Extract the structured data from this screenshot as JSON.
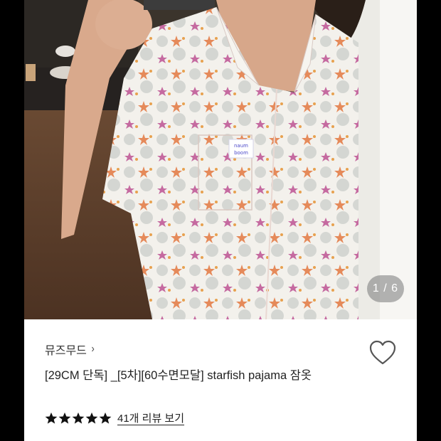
{
  "image": {
    "counter": "1 / 6",
    "patch_text_line1": "naum",
    "patch_text_line2": "boom"
  },
  "product": {
    "brand": "뮤즈무드",
    "brand_chevron": "›",
    "title": "[29CM 단독] _[5차][60수면모달] starfish pajama 잠옷",
    "rating_stars": 5,
    "review_link": "41개 리뷰 보기"
  },
  "colors": {
    "star": "#111111",
    "heart_outline": "#555555",
    "counter_bg": "#787878"
  },
  "icons": {
    "heart": "heart-outline-icon",
    "chevron": "chevron-right-icon",
    "star": "star-filled-icon"
  }
}
